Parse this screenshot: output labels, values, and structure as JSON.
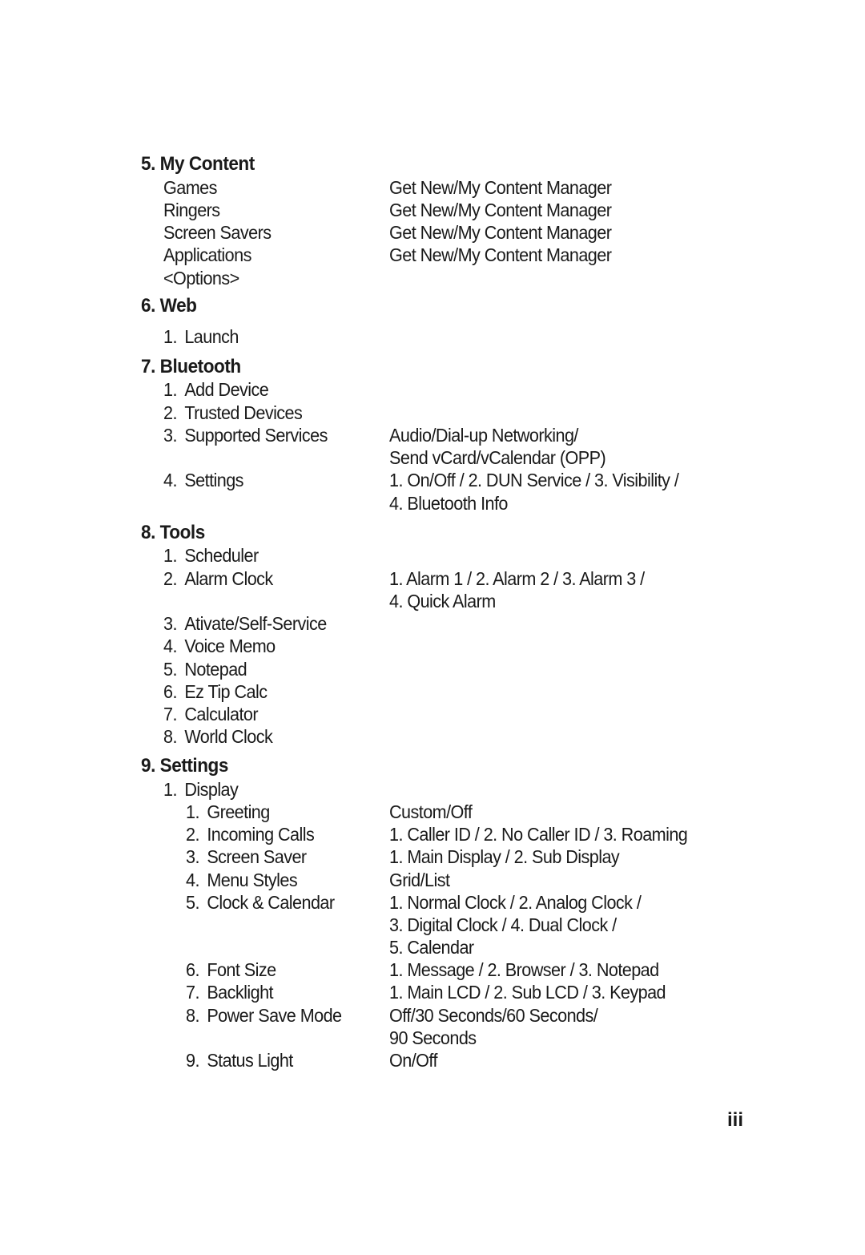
{
  "sections": {
    "my_content": {
      "heading": "5. My Content",
      "items": [
        {
          "label": "Games",
          "value": "Get New/My Content Manager"
        },
        {
          "label": "Ringers",
          "value": "Get New/My Content Manager"
        },
        {
          "label": "Screen Savers",
          "value": "Get New/My Content Manager"
        },
        {
          "label": "Applications",
          "value": "Get New/My Content Manager"
        },
        {
          "label": "<Options>"
        }
      ]
    },
    "web": {
      "heading": "6. Web",
      "items": [
        {
          "num": "1.",
          "label": "Launch"
        }
      ]
    },
    "bluetooth": {
      "heading": "7. Bluetooth",
      "items": [
        {
          "num": "1.",
          "label": "Add Device"
        },
        {
          "num": "2.",
          "label": "Trusted Devices"
        },
        {
          "num": "3.",
          "label": "Supported Services",
          "value": [
            "Audio/Dial-up Networking/",
            "Send vCard/vCalendar (OPP)"
          ]
        },
        {
          "num": "4.",
          "label": "Settings",
          "value": [
            "1. On/Off / 2. DUN Service / 3. Visibility /",
            "4. Bluetooth Info"
          ]
        }
      ]
    },
    "tools": {
      "heading": "8. Tools",
      "items": [
        {
          "num": "1.",
          "label": "Scheduler"
        },
        {
          "num": "2.",
          "label": "Alarm Clock",
          "value": [
            "1. Alarm 1 / 2. Alarm 2 / 3. Alarm 3 /",
            "4. Quick Alarm"
          ]
        },
        {
          "num": "3.",
          "label": "Ativate/Self-Service"
        },
        {
          "num": "4.",
          "label": "Voice Memo"
        },
        {
          "num": "5.",
          "label": "Notepad"
        },
        {
          "num": "6.",
          "label": "Ez Tip Calc"
        },
        {
          "num": "7.",
          "label": "Calculator"
        },
        {
          "num": "8.",
          "label": "World Clock"
        }
      ]
    },
    "settings": {
      "heading": "9. Settings",
      "items": [
        {
          "num": "1.",
          "label": "Display",
          "children": [
            {
              "num": "1.",
              "label": "Greeting",
              "value": [
                "Custom/Off"
              ]
            },
            {
              "num": "2.",
              "label": "Incoming Calls",
              "value": [
                "1. Caller ID / 2. No Caller ID / 3. Roaming"
              ]
            },
            {
              "num": "3.",
              "label": "Screen Saver",
              "value": [
                "1. Main Display / 2. Sub Display"
              ]
            },
            {
              "num": "4.",
              "label": "Menu Styles",
              "value": [
                "Grid/List"
              ]
            },
            {
              "num": "5.",
              "label": "Clock & Calendar",
              "value": [
                "1. Normal Clock / 2. Analog Clock /",
                "3. Digital Clock / 4. Dual Clock /",
                "5. Calendar"
              ]
            },
            {
              "num": "6.",
              "label": "Font Size",
              "value": [
                "1. Message / 2. Browser / 3. Notepad"
              ]
            },
            {
              "num": "7.",
              "label": "Backlight",
              "value": [
                "1. Main LCD / 2. Sub LCD / 3. Keypad"
              ]
            },
            {
              "num": "8.",
              "label": "Power Save Mode",
              "value": [
                "Off/30 Seconds/60 Seconds/",
                "90 Seconds"
              ]
            },
            {
              "num": "9.",
              "label": "Status Light",
              "value": [
                "On/Off"
              ]
            }
          ]
        }
      ]
    }
  },
  "page_number": "iii"
}
